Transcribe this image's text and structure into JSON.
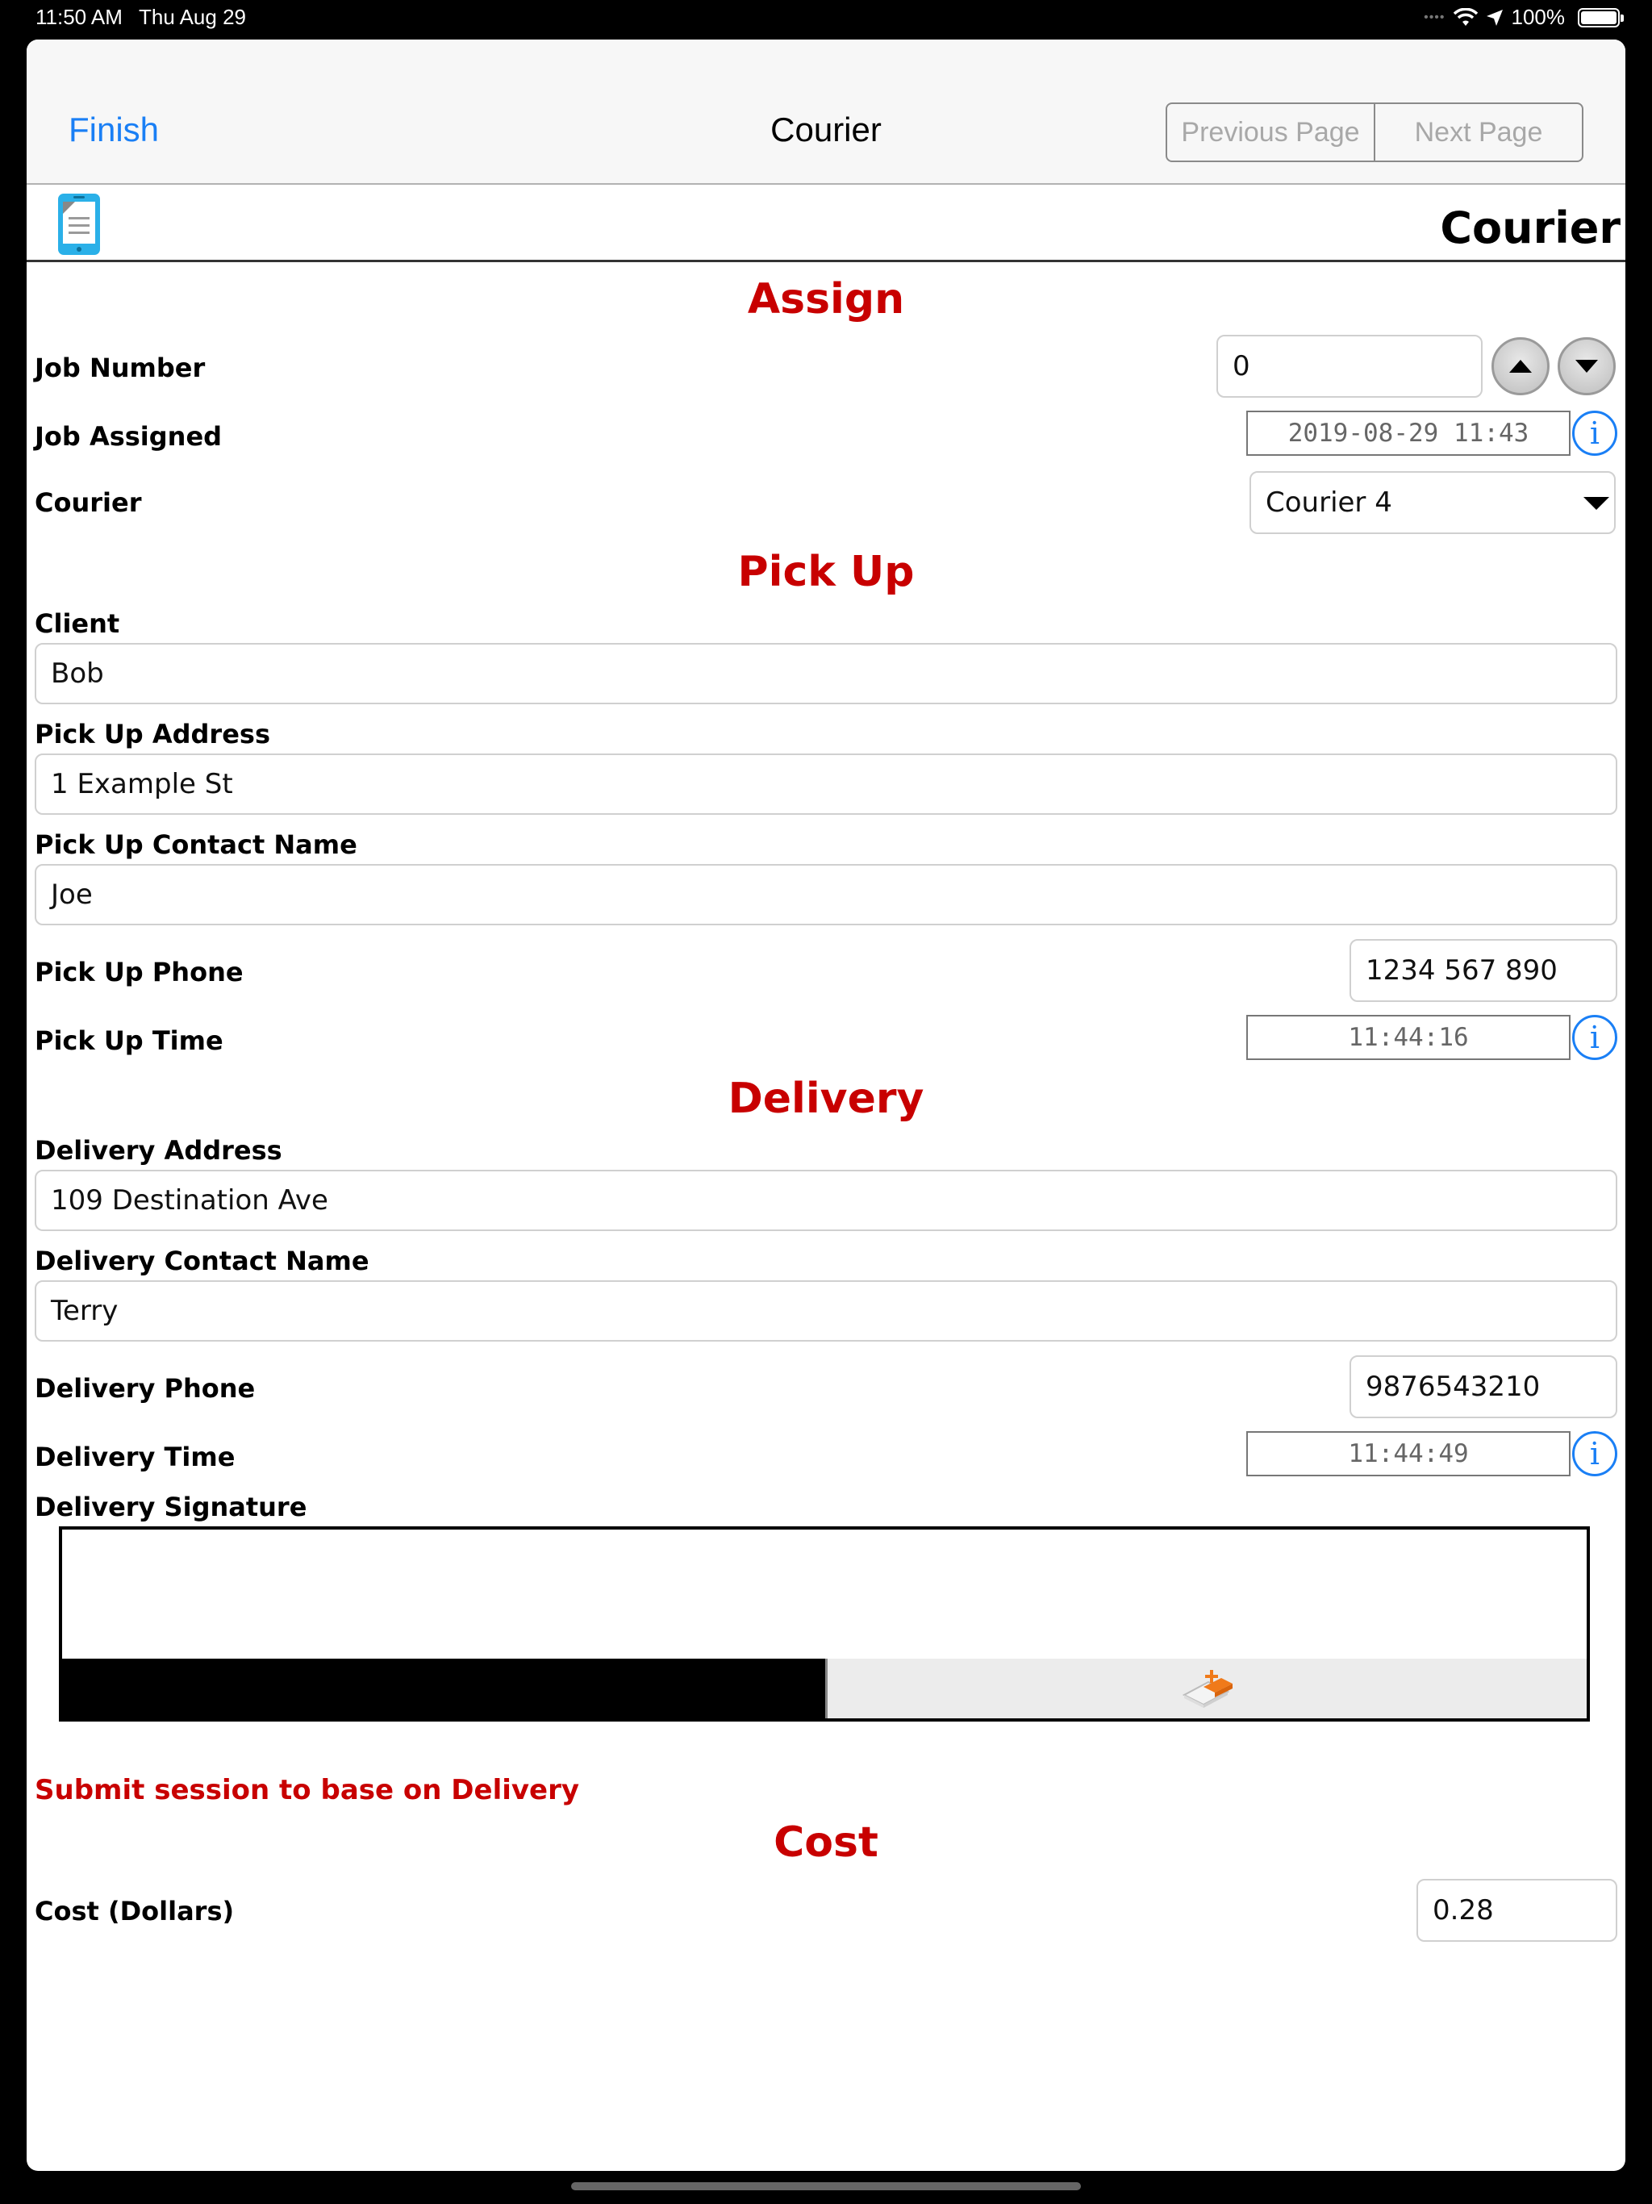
{
  "status_bar": {
    "time": "11:50 AM",
    "date": "Thu Aug 29",
    "battery": "100%",
    "wifi_icon": "wifi-icon",
    "location_icon": "location-arrow-icon"
  },
  "nav": {
    "finish": "Finish",
    "title": "Courier",
    "previous_page": "Previous Page",
    "next_page": "Next Page"
  },
  "form_header": {
    "title": "Courier",
    "icon": "mobile-form-icon"
  },
  "sections": {
    "assign": "Assign",
    "pickup": "Pick Up",
    "delivery": "Delivery",
    "cost": "Cost"
  },
  "assign": {
    "job_number_label": "Job Number",
    "job_number_value": "0",
    "job_assigned_label": "Job Assigned",
    "job_assigned_value": "2019-08-29 11:43",
    "courier_label": "Courier",
    "courier_value": "Courier 4"
  },
  "pickup": {
    "client_label": "Client",
    "client_value": "Bob",
    "address_label": "Pick Up Address",
    "address_value": "1 Example St",
    "contact_label": "Pick Up Contact Name",
    "contact_value": "Joe",
    "phone_label": "Pick Up Phone",
    "phone_value": "1234 567 890",
    "time_label": "Pick Up Time",
    "time_value": "11:44:16"
  },
  "delivery": {
    "address_label": "Delivery Address",
    "address_value": "109 Destination Ave",
    "contact_label": "Delivery Contact Name",
    "contact_value": "Terry",
    "phone_label": "Delivery Phone",
    "phone_value": "9876543210",
    "time_label": "Delivery Time",
    "time_value": "11:44:49",
    "signature_label": "Delivery Signature",
    "submit_note": "Submit session to base on Delivery"
  },
  "cost": {
    "label": "Cost (Dollars)",
    "value": "0.28"
  },
  "colors": {
    "accent_blue": "#1a7ff5",
    "section_red": "#c80000"
  }
}
